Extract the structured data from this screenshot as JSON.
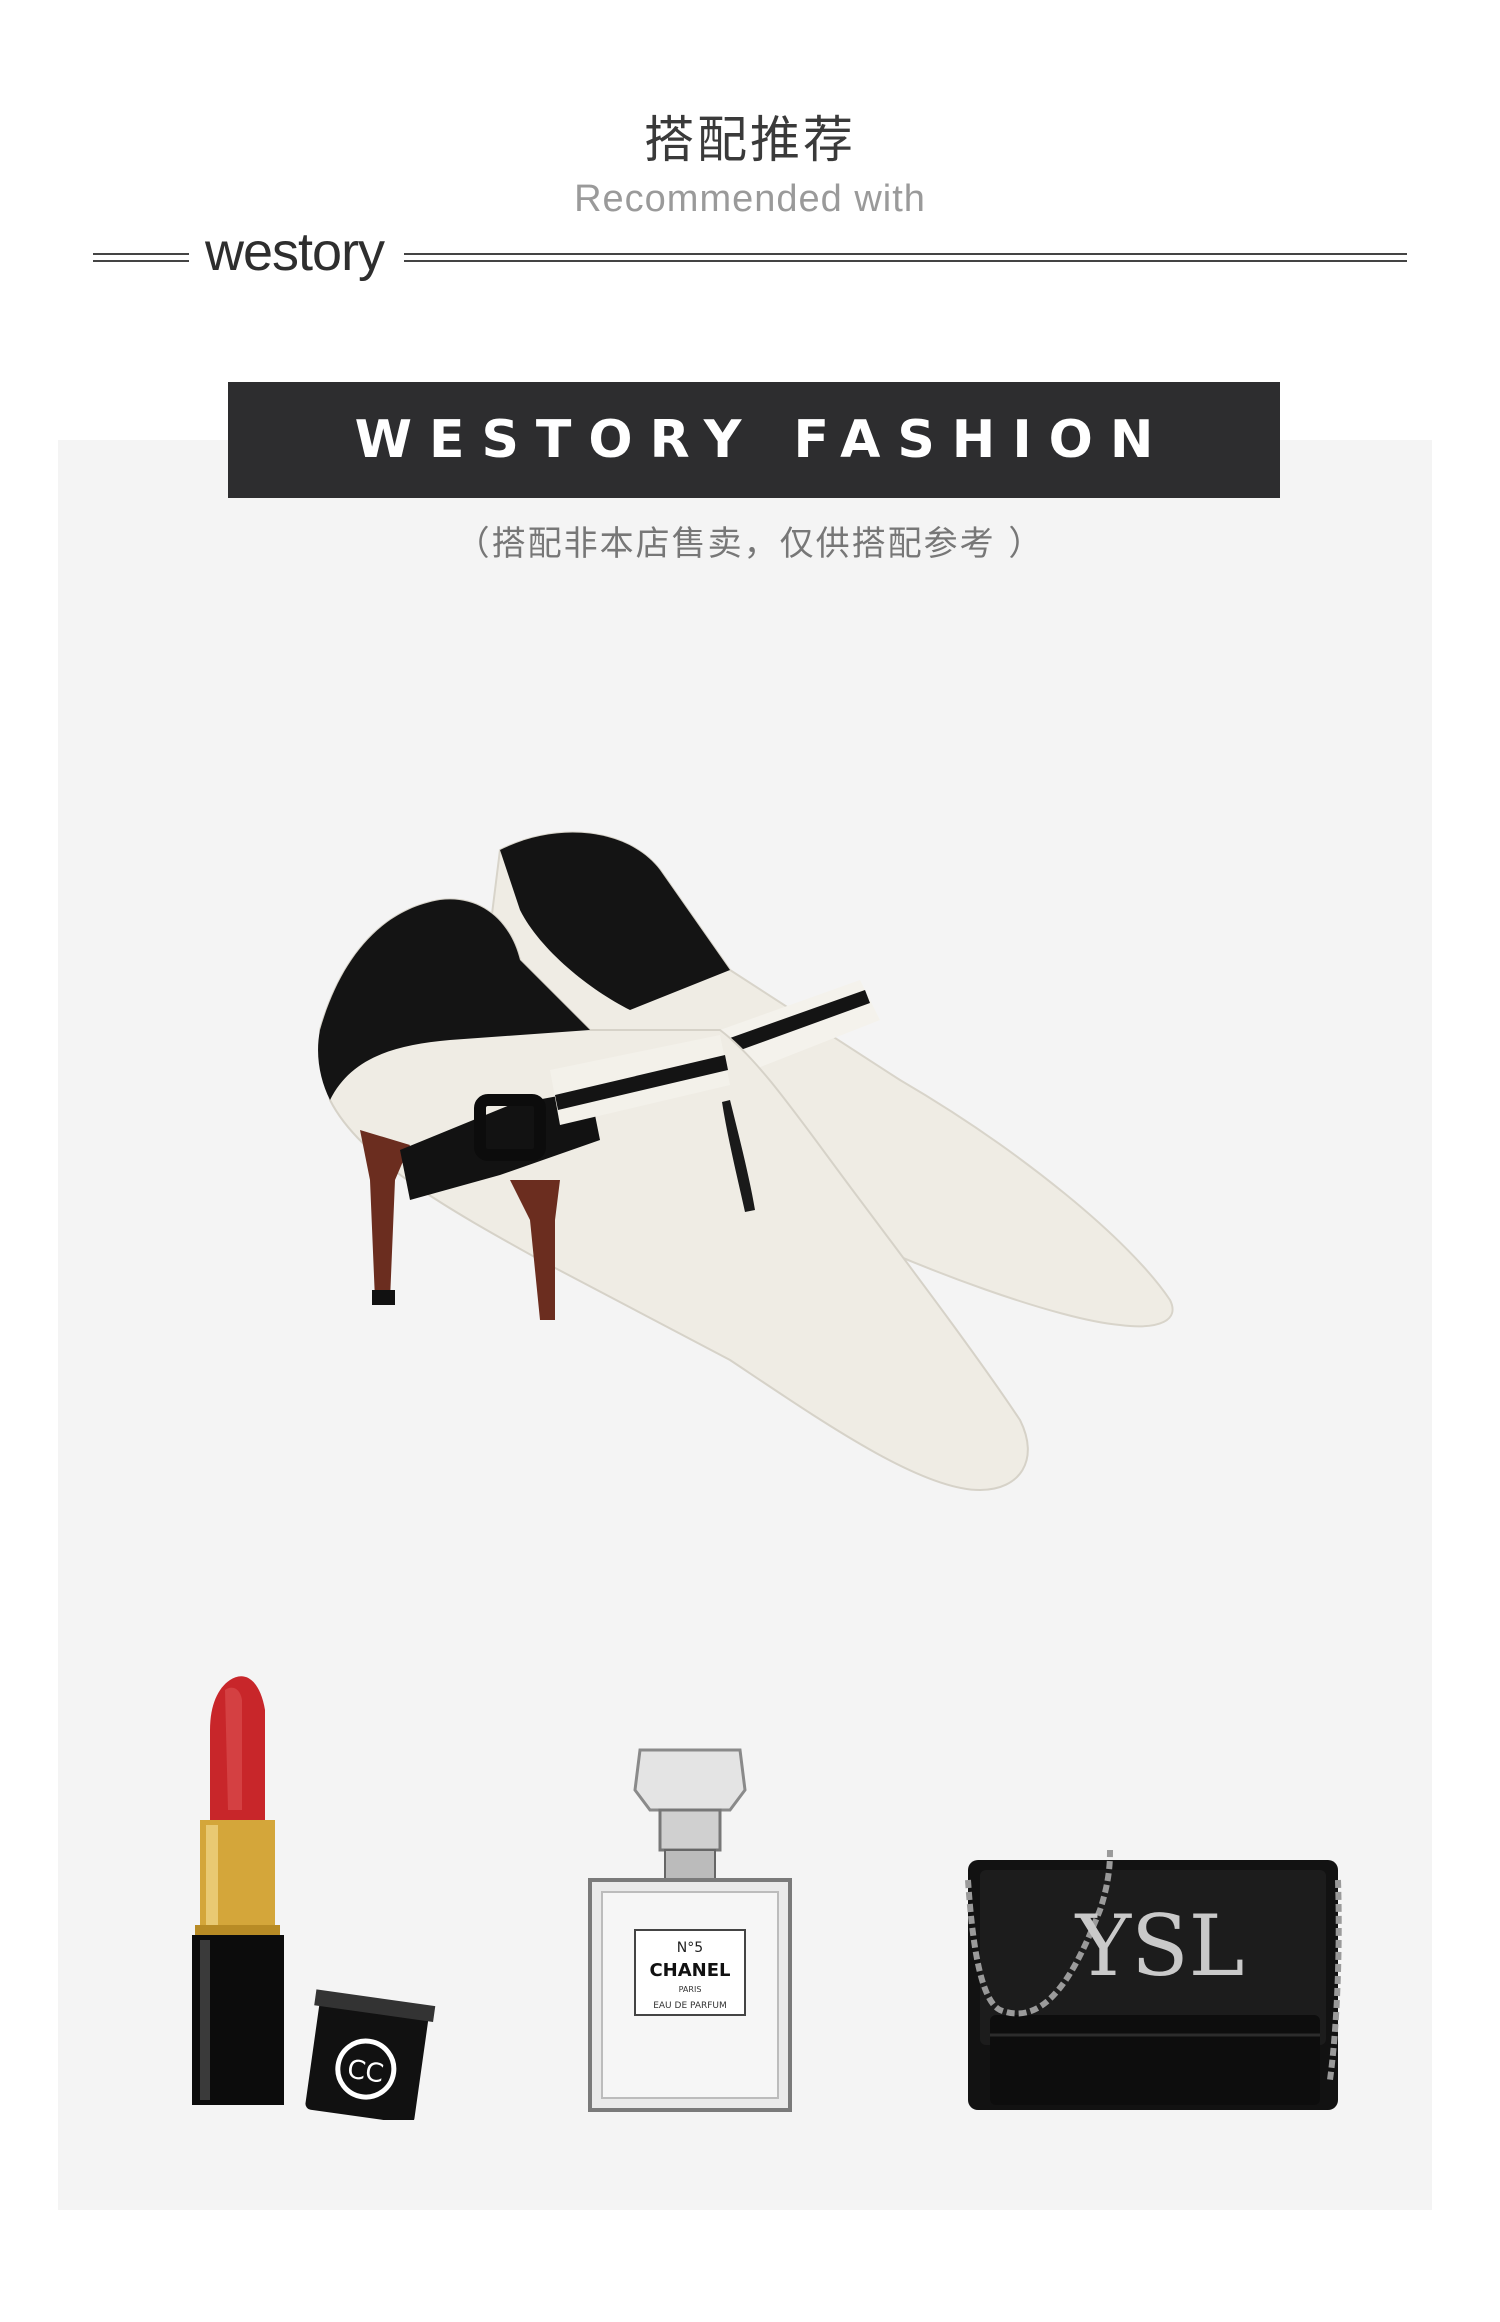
{
  "header": {
    "title_cn": "搭配推荐",
    "title_en": "Recommended with",
    "brand_logo": "westory"
  },
  "banner": {
    "text": "WESTORY FASHION"
  },
  "notice": "（搭配非本店售卖，仅供搭配参考 ）",
  "products": {
    "main": {
      "icon": "heeled-ankle-boots-icon"
    },
    "accessories": [
      {
        "icon": "lipstick-icon",
        "label": "CHANEL"
      },
      {
        "icon": "perfume-bottle-icon",
        "label_lines": [
          "N°5",
          "CHANEL",
          "PARIS",
          "EAU DE PARFUM"
        ]
      },
      {
        "icon": "handbag-icon",
        "label": "YSL"
      }
    ]
  },
  "colors": {
    "banner_bg": "#2d2d2f",
    "panel_bg": "#f4f4f4",
    "lipstick_red": "#c8262a",
    "gold": "#d4a63a"
  }
}
